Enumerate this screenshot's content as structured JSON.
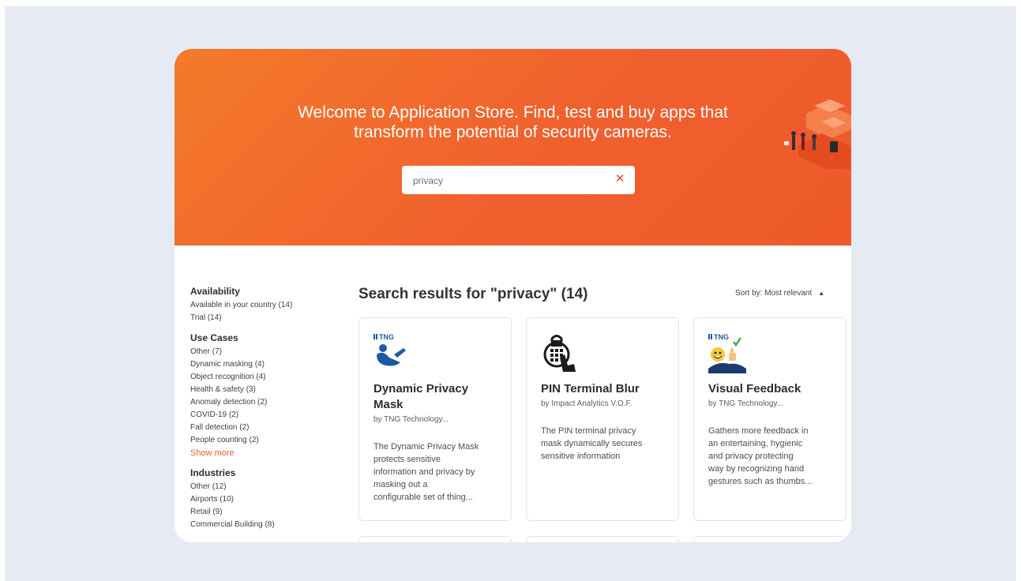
{
  "hero": {
    "title_line1": "Welcome to Application Store. Find, test and buy apps that",
    "title_line2": "transform the potential of security cameras."
  },
  "search": {
    "value": "privacy",
    "clear_icon": "close-icon"
  },
  "sidebar": {
    "availability": {
      "heading": "Availability",
      "items": [
        "Available in your country (14)",
        "Trial (14)"
      ]
    },
    "use_cases": {
      "heading": "Use Cases",
      "items": [
        "Other (7)",
        "Dynamic masking (4)",
        "Object recognition (4)",
        "Health & safety (3)",
        "Anomaly detection (2)",
        "COVID-19 (2)",
        "Fall detection (2)",
        "People counting (2)"
      ],
      "show_more": "Show more"
    },
    "industries": {
      "heading": "Industries",
      "items": [
        "Other (12)",
        "Airports (10)",
        "Retail (9)",
        "Commercial Building (8)"
      ]
    }
  },
  "results": {
    "title": "Search results for \"privacy\" (14)",
    "sort_label": "Sort by: Most relevant",
    "cards": [
      {
        "name_line1": "Dynamic Privacy",
        "name_line2": "Mask",
        "vendor": "by TNG Technology...",
        "description": [
          "The Dynamic Privacy Mask",
          "protects sensitive",
          "information and privacy by",
          "masking out a",
          "configurable set of thing..."
        ],
        "logo_text": "TNG"
      },
      {
        "name_line1": "PIN Terminal Blur",
        "name_line2": "",
        "vendor": "by Impact Analytics V.O.F.",
        "description": [
          "The PIN terminal privacy",
          "mask dynamically secures",
          "sensitive information"
        ],
        "logo_text": ""
      },
      {
        "name_line1": "Visual Feedback",
        "name_line2": "",
        "vendor": "by TNG Technology...",
        "description": [
          "Gathers more feedback in",
          "an entertaining, hygienic",
          "and privacy protecting",
          "way by recognizing hand",
          "gestures such as thumbs..."
        ],
        "logo_text": "TNG"
      }
    ]
  },
  "colors": {
    "accent": "#ee5b2b",
    "hero_start": "#f47a2a",
    "hero_end": "#ee5a2a",
    "page_bg": "#e6eaf3"
  }
}
